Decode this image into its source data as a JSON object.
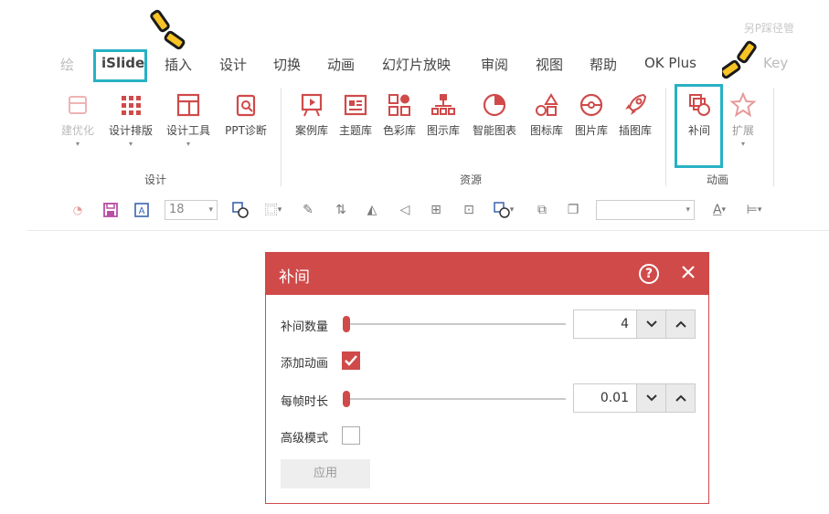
{
  "top_right_text": "另P踩径管",
  "menu": {
    "items": [
      {
        "label": "绘",
        "faded": true
      },
      {
        "label": "iSlide"
      },
      {
        "label": "插入"
      },
      {
        "label": "设计"
      },
      {
        "label": "切换"
      },
      {
        "label": "动画"
      },
      {
        "label": "幻灯片放映"
      },
      {
        "label": "审阅"
      },
      {
        "label": "视图"
      },
      {
        "label": "帮助"
      },
      {
        "label": "OK Plus"
      },
      {
        "label": "Key",
        "faded": true
      }
    ]
  },
  "ribbon": {
    "design_buttons": [
      {
        "label": "建优化",
        "icon": "optimize-icon"
      },
      {
        "label": "设计排版",
        "icon": "grid-layout-icon"
      },
      {
        "label": "设计工具",
        "icon": "design-tools-icon"
      },
      {
        "label": "PPT诊断",
        "icon": "diagnose-icon"
      }
    ],
    "resource_buttons": [
      {
        "label": "案例库",
        "icon": "case-library-icon"
      },
      {
        "label": "主题库",
        "icon": "theme-library-icon"
      },
      {
        "label": "色彩库",
        "icon": "color-library-icon"
      },
      {
        "label": "图示库",
        "icon": "diagram-library-icon"
      },
      {
        "label": "智能图表",
        "icon": "smart-chart-icon"
      },
      {
        "label": "图标库",
        "icon": "icon-library-icon"
      },
      {
        "label": "图片库",
        "icon": "image-library-icon"
      },
      {
        "label": "插图库",
        "icon": "illustration-library-icon"
      }
    ],
    "animation_buttons": [
      {
        "label": "补间",
        "icon": "tween-icon"
      },
      {
        "label": "扩展",
        "icon": "extend-star-icon"
      }
    ],
    "group_labels": {
      "design": "设计",
      "resource": "资源",
      "animation": "动画"
    }
  },
  "toolbar": {
    "font_size": "18"
  },
  "dialog": {
    "title": "补间",
    "help_symbol": "?",
    "rows": {
      "count_label": "补间数量",
      "count_value": "4",
      "count_fraction": 0.0,
      "add_anim_label": "添加动画",
      "add_anim_checked": true,
      "duration_label": "每帧时长",
      "duration_value": "0.01",
      "duration_fraction": 0.0,
      "advanced_label": "高级模式",
      "advanced_checked": false
    },
    "apply_label": "应用"
  },
  "colors": {
    "accent": "#d04a4a",
    "highlight": "#27b1c4",
    "burst": "#f7c325"
  }
}
